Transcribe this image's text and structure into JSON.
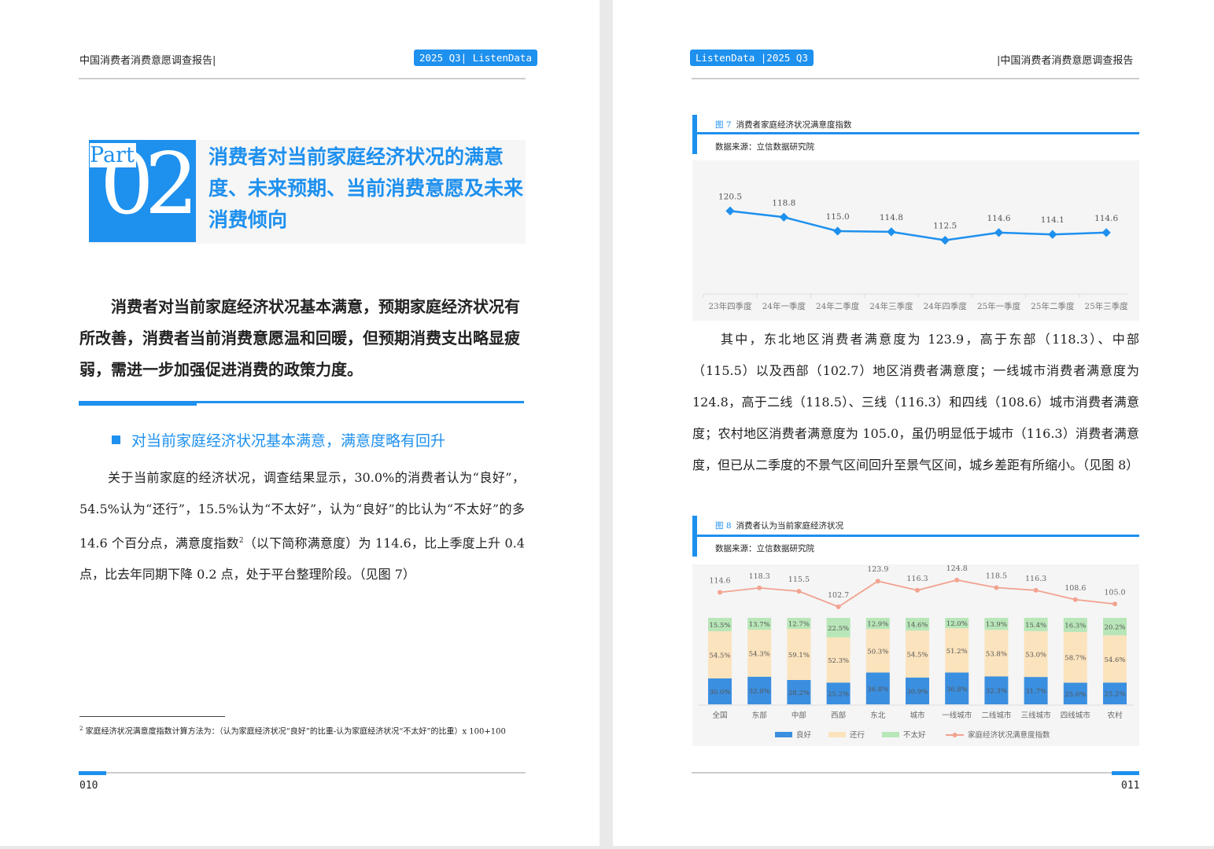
{
  "left_page": {
    "header_title": "中国消费者消费意愿调查报告|",
    "header_tag": "2025 Q3| ListenData",
    "part_word": "Part",
    "part_number": "02",
    "part_title": "消费者对当前家庭经济状况的满意度、未来预期、当前消费意愿及未来消费倾向",
    "lead": "消费者对当前家庭经济状况基本满意，预期家庭经济状况有所改善，消费者当前消费意愿温和回暖，但预期消费支出略显疲弱，需进一步加强促进消费的政策力度。",
    "section_heading": "对当前家庭经济状况基本满意，满意度略有回升",
    "para_before_sup": "关于当前家庭的经济状况，调查结果显示，30.0%的消费者认为“良好”，54.5%认为“还行”，15.5%认为“不太好”，认为“良好”的比认为“不太好”的多 14.6 个百分点，满意度指数",
    "para_sup": "2",
    "para_after_sup": "（以下简称满意度）为 114.6，比上季度上升 0.4 点，比去年同期下降 0.2 点，处于平台整理阶段。（见图 7）",
    "footnote_mark": "2",
    "footnote": "家庭经济状况满意度指数计算方法为：（认为家庭经济状况“良好”的比重-认为家庭经济状况“不太好”的比重）x 100+100",
    "page_number": "010"
  },
  "right_page": {
    "header_tag": "ListenData |2025 Q3",
    "header_title": "|中国消费者消费意愿调查报告",
    "fig7_number": "图 7",
    "fig7_title": "消费者家庭经济状况满意度指数",
    "fig7_source": "数据来源：立信数据研究院",
    "body": "其中，东北地区消费者满意度为 123.9，高于东部（118.3）、中部（115.5）以及西部（102.7）地区消费者满意度；一线城市消费者满意度为 124.8，高于二线（118.5）、三线（116.3）和四线（108.6）城市消费者满意度；农村地区消费者满意度为 105.0，虽仍明显低于城市（116.3）消费者满意度，但已从二季度的不景气区间回升至景气区间，城乡差距有所缩小。（见图 8）",
    "fig8_number": "图 8",
    "fig8_title": "消费者认为当前家庭经济状况",
    "fig8_source": "数据来源：立信数据研究院",
    "page_number": "011"
  },
  "colors": {
    "accent": "#1e90ee",
    "good": "#3b8fe0",
    "ok": "#fbe3bd",
    "bad": "#b8e6b8",
    "index_line": "#f2a391"
  },
  "chart_data": [
    {
      "type": "line",
      "categories": [
        "23年四季度",
        "24年一季度",
        "24年二季度",
        "24年三季度",
        "24年四季度",
        "25年一季度",
        "25年二季度",
        "25年三季度"
      ],
      "values": [
        120.5,
        118.8,
        115.0,
        114.8,
        112.5,
        114.6,
        114.1,
        114.6
      ],
      "value_labels": [
        "120.5",
        "118.8",
        "115.0",
        "114.8",
        "112.5",
        "114.6",
        "114.1",
        "114.6"
      ],
      "ylim": [
        100,
        130
      ],
      "grid": false
    },
    {
      "type": "bar",
      "stacked": true,
      "categories": [
        "全国",
        "东部",
        "中部",
        "西部",
        "东北",
        "城市",
        "一线城市",
        "二线城市",
        "三线城市",
        "四线城市",
        "农村"
      ],
      "series": [
        {
          "name": "良好",
          "values": [
            30.0,
            32.0,
            28.2,
            25.2,
            36.8,
            30.9,
            36.8,
            32.3,
            31.7,
            25.0,
            25.2
          ],
          "labels": [
            "30.0%",
            "32.0%",
            "28.2%",
            "25.2%",
            "36.8%",
            "30.9%",
            "36.8%",
            "32.3%",
            "31.7%",
            "25.0%",
            "25.2%"
          ]
        },
        {
          "name": "还行",
          "values": [
            54.5,
            54.3,
            59.1,
            52.3,
            50.3,
            54.5,
            51.2,
            53.8,
            53.0,
            58.7,
            54.6
          ],
          "labels": [
            "54.5%",
            "54.3%",
            "59.1%",
            "52.3%",
            "50.3%",
            "54.5%",
            "51.2%",
            "53.8%",
            "53.0%",
            "58.7%",
            "54.6%"
          ]
        },
        {
          "name": "不太好",
          "values": [
            15.5,
            13.7,
            12.7,
            22.5,
            12.9,
            14.6,
            12.0,
            13.9,
            15.4,
            16.3,
            20.2
          ],
          "labels": [
            "15.5%",
            "13.7%",
            "12.7%",
            "22.5%",
            "12.9%",
            "14.6%",
            "12.0%",
            "13.9%",
            "15.4%",
            "16.3%",
            "20.2%"
          ]
        }
      ],
      "line_series": {
        "name": "家庭经济状况满意度指数",
        "values": [
          114.6,
          118.3,
          115.5,
          102.7,
          123.9,
          116.3,
          124.8,
          118.5,
          116.3,
          108.6,
          105.0
        ],
        "labels": [
          "114.6",
          "118.3",
          "115.5",
          "102.7",
          "123.9",
          "116.3",
          "124.8",
          "118.5",
          "116.3",
          "108.6",
          "105.0"
        ]
      },
      "ylim": [
        0,
        100
      ],
      "legend": "bottom"
    }
  ]
}
